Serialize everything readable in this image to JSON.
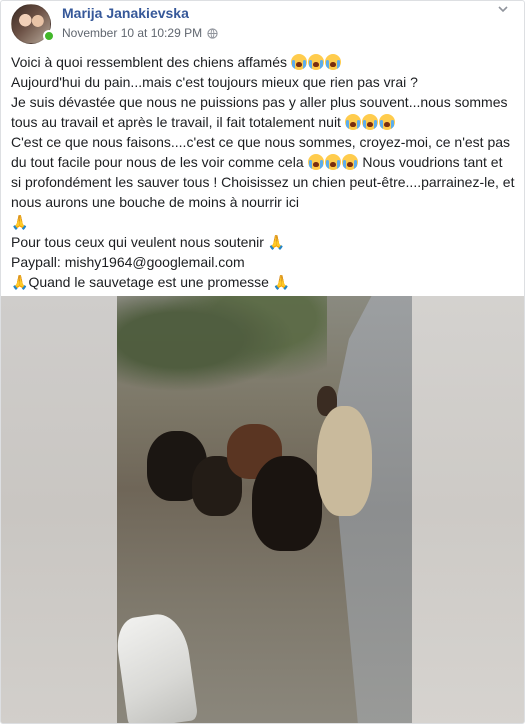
{
  "post": {
    "author": "Marija Janakievska",
    "timestamp": "November 10 at 10:29 PM",
    "lines": [
      {
        "text": "Voici à quoi ressemblent des chiens affamés",
        "emoji_after": 3
      },
      {
        "text": "Aujourd'hui du pain...mais c'est toujours mieux que rien pas vrai ?",
        "emoji_after": 0
      },
      {
        "text": "Je suis dévastée que nous ne puissions pas y aller plus souvent...nous sommes tous au travail et après le travail, il fait totalement nuit",
        "emoji_after": 3
      },
      {
        "text": "C'est ce que nous faisons....c'est ce que nous sommes, croyez-moi, ce n'est pas du tout facile pour nous de les voir comme cela",
        "emoji_after": 3,
        "continued": "Nous voudrions tant et si profondément les sauver tous ! Choisissez un chien peut-être....parrainez-le, et nous aurons une bouche de moins à nourrir ici",
        "pray_after": true
      },
      {
        "text": "Pour tous ceux qui veulent nous soutenir",
        "pray_after": true
      },
      {
        "text": "Paypall: mishy1964@googlemail.com"
      },
      {
        "text": "Quand le sauvetage est une promesse",
        "pray_before": true,
        "pray_after": true
      }
    ],
    "pray_glyph": "🙏"
  },
  "icons": {
    "globe": "globe-icon",
    "options": "chevron-down-icon",
    "crying": "crying-face-emoji",
    "pray": "folded-hands-emoji"
  },
  "colors": {
    "author": "#365899",
    "meta": "#616770",
    "online": "#42b72a"
  }
}
